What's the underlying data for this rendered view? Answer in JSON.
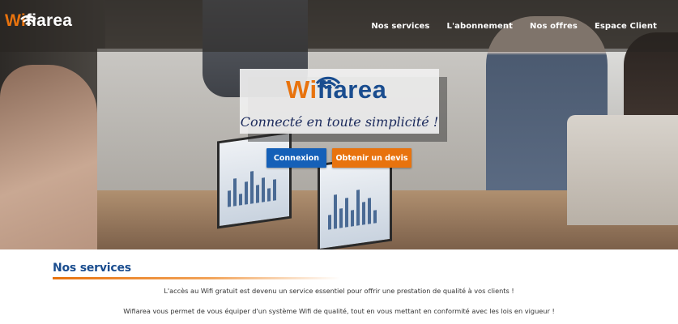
{
  "brand": {
    "name_part1": "Wi",
    "name_part2": "fiarea",
    "colors": {
      "orange": "#e8730e",
      "blue": "#1a4d8f",
      "white": "#ffffff"
    }
  },
  "nav": {
    "items": [
      {
        "label": "Nos services"
      },
      {
        "label": "L'abonnement"
      },
      {
        "label": "Nos offres"
      },
      {
        "label": "Espace Client"
      }
    ]
  },
  "hero": {
    "logo_part1": "Wi",
    "logo_part2": "fiarea",
    "tagline": "Connecté en toute simplicité !",
    "buttons": {
      "login": "Connexion",
      "quote": "Obtenir un devis"
    },
    "button_colors": {
      "login": "#1560b8",
      "quote": "#e8730e"
    }
  },
  "services": {
    "title": "Nos services",
    "paragraph1": "L'accès au Wifi gratuit est devenu un service essentiel pour offrir une prestation de qualité à vos clients !",
    "paragraph2": "Wifiarea vous permet de vous équiper d'un système Wifi de qualité, tout en vous mettant en conformité avec les lois en vigueur !"
  }
}
